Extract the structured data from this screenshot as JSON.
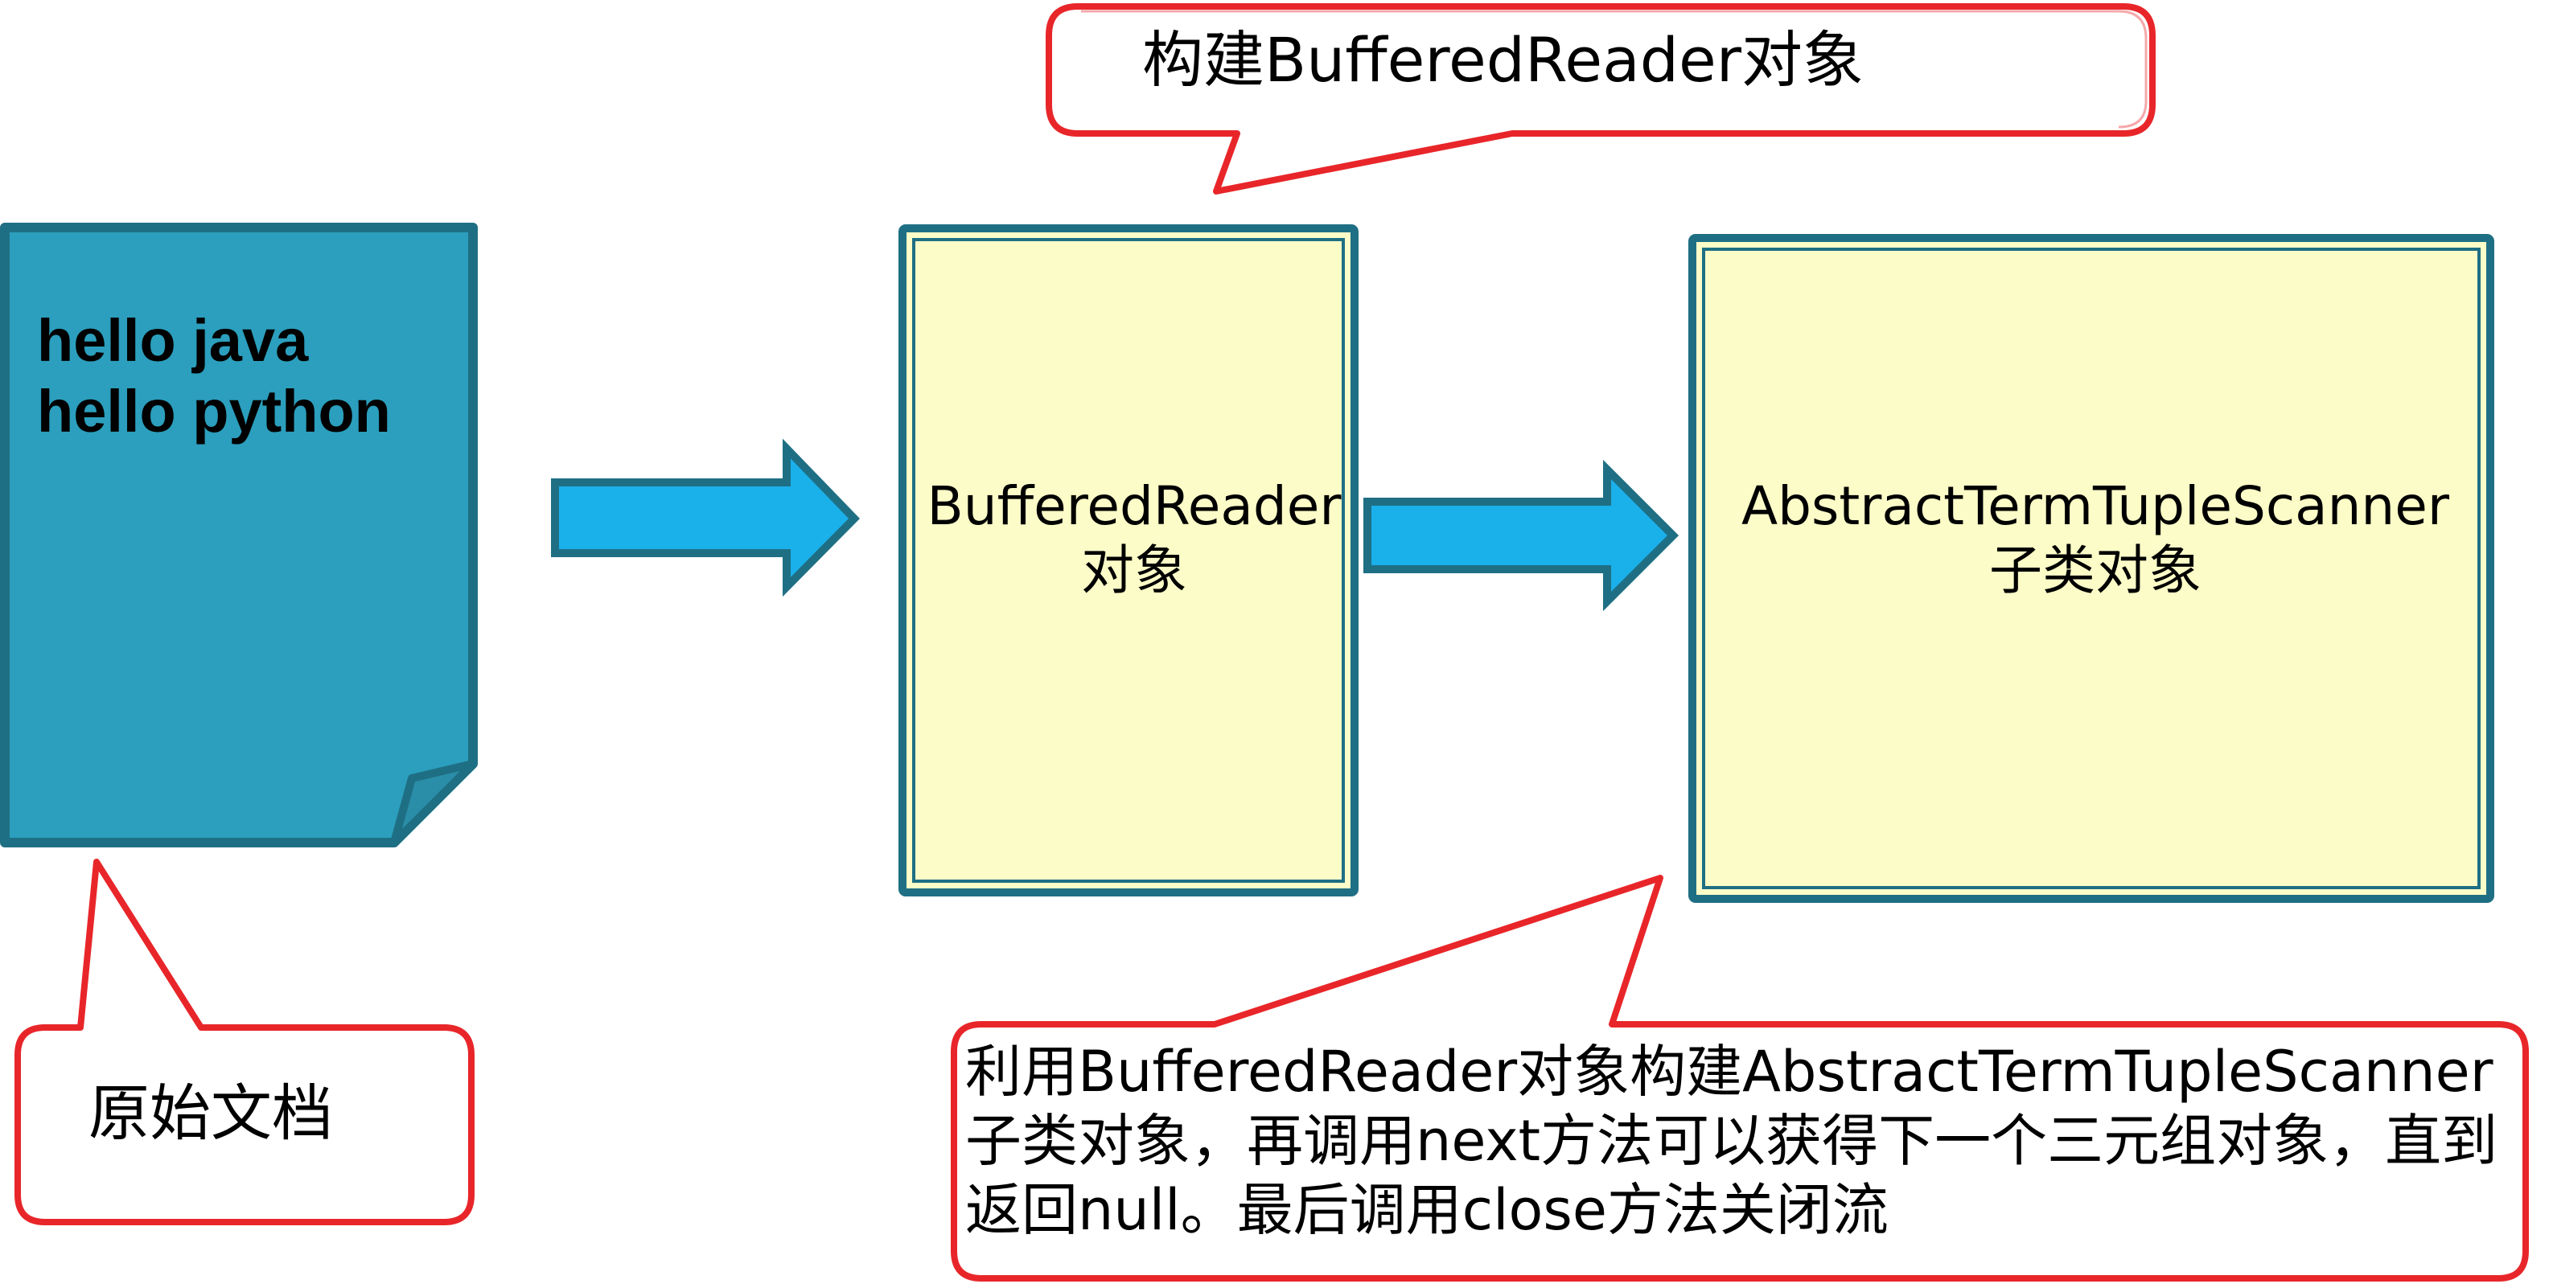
{
  "document": {
    "lines": [
      "hello java",
      "hello python"
    ],
    "fill_color": "#2b9fbd",
    "border_color": "#1f6f84"
  },
  "reader_box": {
    "lines": [
      "BufferedReader",
      "对象"
    ],
    "fill_color": "#fcfcc8",
    "border_color": "#1f6f84"
  },
  "scanner_box": {
    "lines": [
      "AbstractTermTupleScanner",
      "子类对象"
    ],
    "fill_color": "#fcfcc8",
    "border_color": "#1f6f84"
  },
  "arrow_color": "#1ab0ea",
  "callouts": {
    "build_reader": "构建BufferedReader对象",
    "raw_document": "原始文档",
    "explanation": "利用BufferedReader对象构建AbstractTermTupleScanner子类对象，再调用next方法可以获得下一个三元组对象，直到返回null。最后调用close方法关闭流",
    "border_color": "#e8262a"
  }
}
